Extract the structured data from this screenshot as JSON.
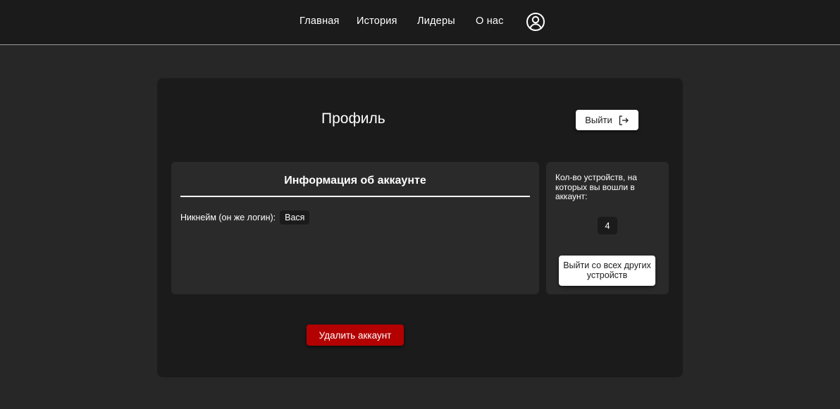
{
  "nav": {
    "items": [
      {
        "label": "Главная"
      },
      {
        "label": "История"
      },
      {
        "label": "Лидеры"
      },
      {
        "label": "О нас"
      }
    ],
    "profile_icon": "user-circle-icon"
  },
  "profile": {
    "title": "Профиль",
    "logout_label": "Выйти",
    "logout_icon": "logout-arrow-icon"
  },
  "account_info": {
    "title": "Информация об аккаунте",
    "nickname_label": "Никнейм (он же логин):",
    "nickname_value": "Вася"
  },
  "devices": {
    "label": "Кол-во устройств, на которых вы вошли в аккаунт:",
    "count": "4",
    "logout_all_label": "Выйти со всех других устройств"
  },
  "danger": {
    "delete_label": "Удалить аккаунт"
  },
  "colors": {
    "background": "#272727",
    "card": "#1b1b1b",
    "panel": "#2a2a2a",
    "danger": "#b30000"
  }
}
